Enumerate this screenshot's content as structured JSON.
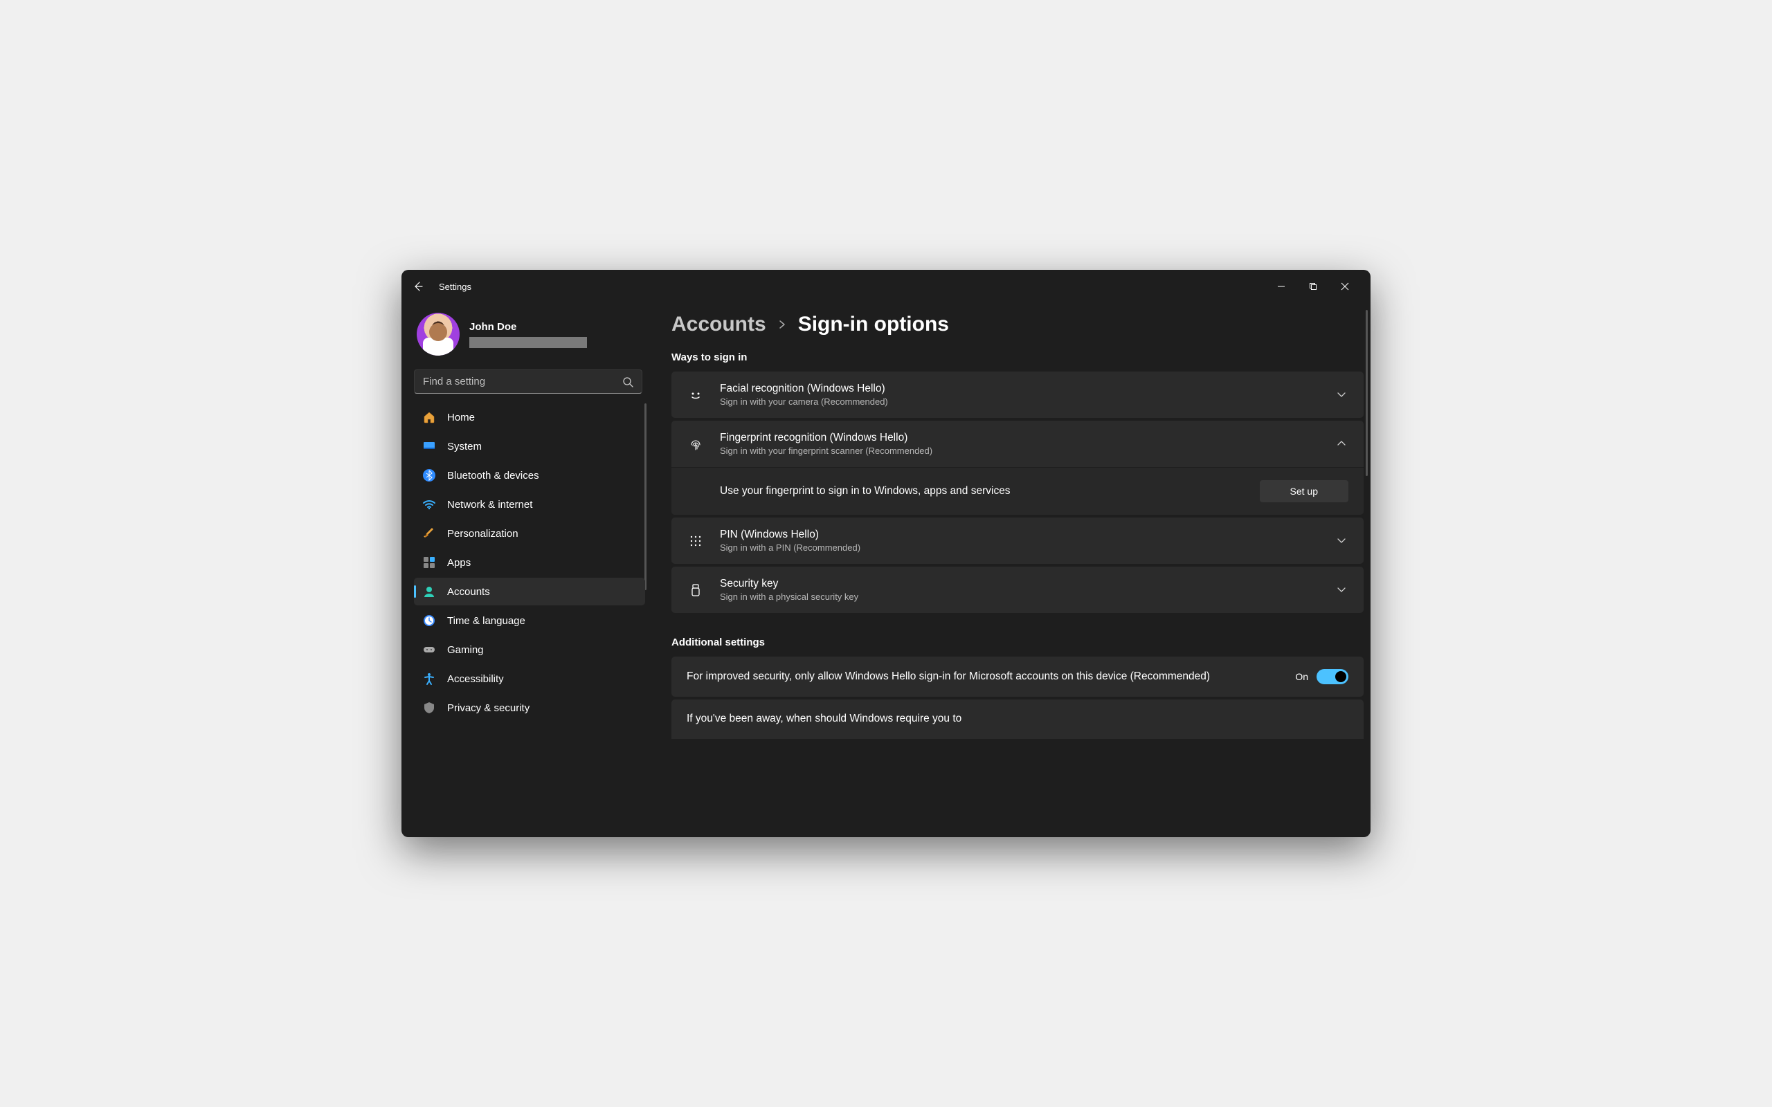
{
  "app_title": "Settings",
  "user": {
    "name": "John Doe"
  },
  "search": {
    "placeholder": "Find a setting"
  },
  "sidebar": {
    "items": [
      {
        "label": "Home"
      },
      {
        "label": "System"
      },
      {
        "label": "Bluetooth & devices"
      },
      {
        "label": "Network & internet"
      },
      {
        "label": "Personalization"
      },
      {
        "label": "Apps"
      },
      {
        "label": "Accounts"
      },
      {
        "label": "Time & language"
      },
      {
        "label": "Gaming"
      },
      {
        "label": "Accessibility"
      },
      {
        "label": "Privacy & security"
      }
    ]
  },
  "breadcrumb": {
    "parent": "Accounts",
    "current": "Sign-in options"
  },
  "sections": {
    "ways": {
      "title": "Ways to sign in",
      "items": [
        {
          "title": "Facial recognition (Windows Hello)",
          "sub": "Sign in with your camera (Recommended)"
        },
        {
          "title": "Fingerprint recognition (Windows Hello)",
          "sub": "Sign in with your fingerprint scanner (Recommended)",
          "body": "Use your fingerprint to sign in to Windows, apps and services",
          "button": "Set up"
        },
        {
          "title": "PIN (Windows Hello)",
          "sub": "Sign in with a PIN (Recommended)"
        },
        {
          "title": "Security key",
          "sub": "Sign in with a physical security key"
        }
      ]
    },
    "additional": {
      "title": "Additional settings",
      "hello_only": {
        "text": "For improved security, only allow Windows Hello sign-in for Microsoft accounts on this device (Recommended)",
        "state": "On"
      },
      "away": {
        "text": "If you've been away, when should Windows require you to"
      }
    }
  }
}
